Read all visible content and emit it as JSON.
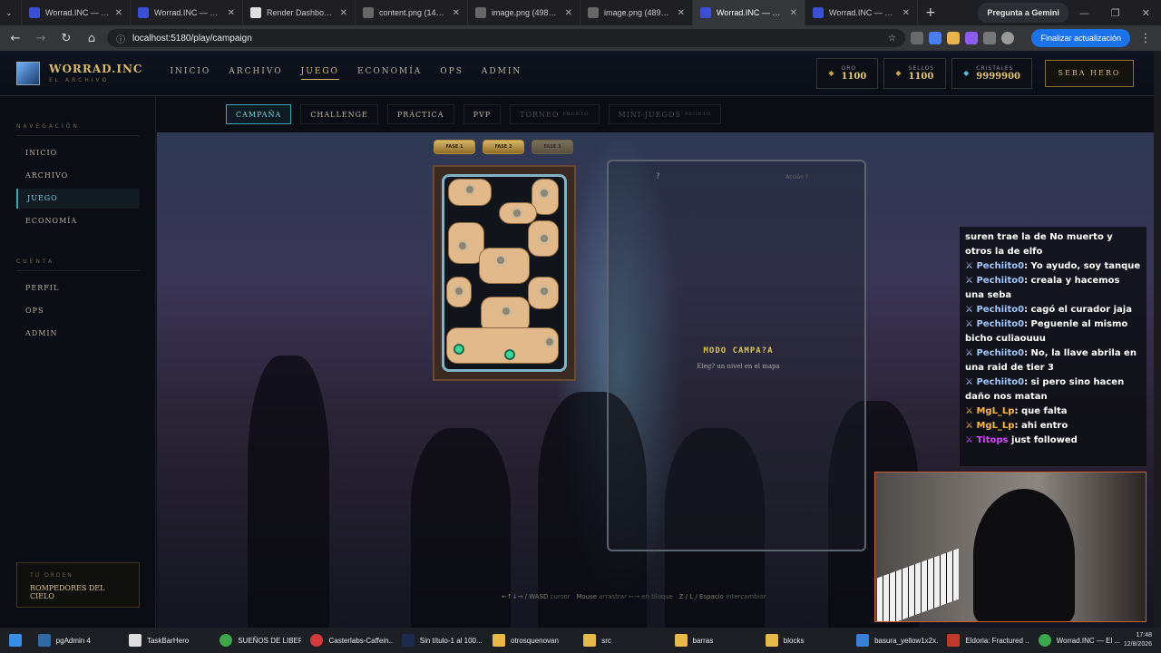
{
  "browser": {
    "tabs": [
      "Worrad.INC — El Archivo",
      "Worrad.INC — El Archivo",
      "Render Dashboard",
      "content.png (1448×1086)",
      "image.png (498×210)",
      "image.png (489×213)",
      "Worrad.INC — El Archivo",
      "Worrad.INC — El Archivo"
    ],
    "gemini": "Pregunta a Gemini",
    "url": "localhost:5180/play/campaign",
    "update_label": "Finalizar actualización"
  },
  "header": {
    "brand": "WORRAD.INC",
    "subtitle": "EL ARCHIVO",
    "nav": [
      "INICIO",
      "ARCHIVO",
      "JUEGO",
      "ECONOMÍA",
      "OPS",
      "ADMIN"
    ],
    "currencies": [
      {
        "label": "ORO",
        "value": "1100"
      },
      {
        "label": "SELLOS",
        "value": "1100"
      },
      {
        "label": "CRISTALES",
        "value": "9999900"
      }
    ],
    "hero": "SEBA HERO"
  },
  "sidebar": {
    "nav_title": "NAVEGACIÓN",
    "nav_items": [
      "INICIO",
      "ARCHIVO",
      "JUEGO",
      "ECONOMÍA"
    ],
    "account_title": "CUENTA",
    "account_items": [
      "PERFIL",
      "OPS",
      "ADMIN"
    ],
    "order_label": "TU ORDEN",
    "order_value": "ROMPEDORES DEL CIELO"
  },
  "game": {
    "tabs": [
      "CAMPAÑA",
      "CHALLENGE",
      "PRÁCTICA",
      "PVP",
      "TORNEO",
      "MINI-JUEGOS"
    ],
    "tab_suffix": [
      "",
      "",
      "",
      "",
      "PRONTO",
      "PRONTO"
    ],
    "phases": [
      "FASE 1",
      "FASE 2",
      "FASE 3"
    ],
    "panel_q": "?",
    "panel_q2": "Acción ?",
    "mode_title": "MODO CAMPA?A",
    "mode_sub": "Eleg? un nivel en el mapa",
    "hint_1": "←↑↓→ / WASD",
    "hint_2": "cursor",
    "hint_3": "Mouse",
    "hint_4": "arrastrar ←→ en bloque",
    "hint_5": "Z / L / Espacio",
    "hint_6": "intercambiar"
  },
  "chat": {
    "line0": "suren trae la de No muerto y otros la de elfo",
    "m1_user": "Pechiito0",
    "m1_text": ": Yo ayudo, soy tanque",
    "m2_user": "Pechiito0",
    "m2_text": ": creala y hacemos una seba",
    "m3_user": "Pechiito0",
    "m3_text": ": cagó el curador jaja",
    "m4_user": "Pechiito0",
    "m4_text": ": Peguenle al mismo bicho culiaouuu",
    "m5_user": "Pechiito0",
    "m5_text": ": No, la llave abrila en una raid de tier 3",
    "m6_user": "Pechiito0",
    "m6_text": ": si pero sino hacen daño nos matan",
    "m7_user": "MgL_Lp",
    "m7_text": ": que falta",
    "m8_user": "MgL_Lp",
    "m8_text": ": ahi entro",
    "m9_user": "Titops",
    "m9_text": " just followed"
  },
  "taskbar": {
    "items": [
      "pgAdmin 4",
      "TaskBarHero",
      "SUEÑOS DE LIBER...",
      "Casterlabs-Caffein...",
      "Sin título-1 al 100...",
      "otrosquenovan",
      "src",
      "barras",
      "blocks",
      "basura_yellow1x2x...",
      "Eldoria: Fractured ...",
      "Worrad.INC — El ..."
    ],
    "time": "17:48",
    "date": "12/8/2026"
  }
}
